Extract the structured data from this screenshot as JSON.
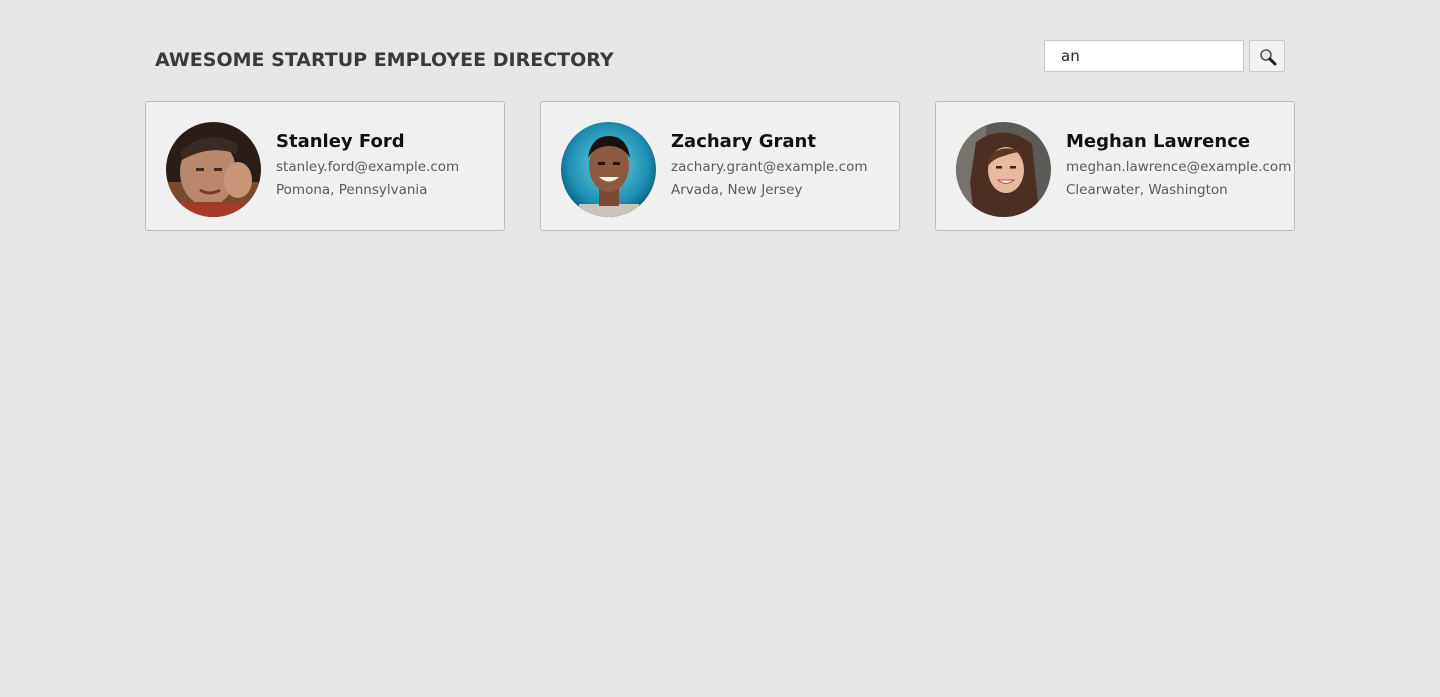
{
  "header": {
    "title": "AWESOME STARTUP EMPLOYEE DIRECTORY"
  },
  "search": {
    "value": "an",
    "button_icon": "magnifier-icon"
  },
  "employees": [
    {
      "name": "Stanley Ford",
      "email": "stanley.ford@example.com",
      "location": "Pomona, Pennsylvania"
    },
    {
      "name": "Zachary Grant",
      "email": "zachary.grant@example.com",
      "location": "Arvada, New Jersey"
    },
    {
      "name": "Meghan Lawrence",
      "email": "meghan.lawrence@example.com",
      "location": "Clearwater, Washington"
    }
  ],
  "colors": {
    "background": "#e7e7e7",
    "card_background": "#f0f0f0",
    "title_text": "#3a3a3a"
  }
}
